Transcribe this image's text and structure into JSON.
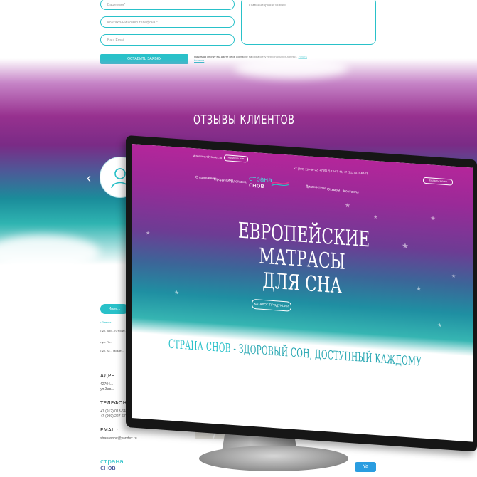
{
  "form": {
    "name_placeholder": "Ваше имя*",
    "phone_placeholder": "Контактный номер телефона *",
    "email_placeholder": "Ваш Email",
    "comment_placeholder": "Комментарий к заявке",
    "submit_label": "Оставить заявку",
    "consent_text": "Нажимая кнопку вы даете свое согласие на обработку персональных данных.",
    "consent_link": "Узнать больше"
  },
  "reviews": {
    "title": "Отзывы клиентов",
    "prev_arrow": "‹"
  },
  "contacts": {
    "button_label": "Инже...",
    "bullet_1": "• Завист...",
    "bullet_2": "• ул. Кир... (Строит...",
    "bullet_3": "• ул. Пр...",
    "bullet_4": "• ул. Ак... (возле...",
    "address_head": "Адре...",
    "address_text": "42704...\nул.Зав...",
    "phones_head": "Телефоны:",
    "phone_1": "+7 (912) 013-64-75",
    "phone_2": "+7 (999) 227-67-36",
    "email_head": "Email:",
    "email_value": "stranasnov@yandex.ru",
    "logo_top": "стрaна",
    "logo_bottom": "снов",
    "corner_badge": "Ya"
  },
  "screen": {
    "email": "stranasnov@yandex.ru",
    "write_us": "Написать нам",
    "phones": "+7 (999) 110-36-22, +7 (912) 13-87-46, +7 (912) 013-64-75",
    "call_me": "Заказать звонок",
    "nav_left": [
      "О компании",
      "Продукция",
      "Доставка"
    ],
    "nav_right": [
      "Диагностика",
      "Отзывы",
      "Контакты"
    ],
    "logo_top": "стрaна",
    "logo_bottom": "снов",
    "headline_line1": "Европейские",
    "headline_line2": "матрасы для сна",
    "cta_label": "Каталог продукции",
    "slogan_part1": "Страна снов",
    "slogan_part2": " - здоровый сон, доступный каждому"
  },
  "colors": {
    "accent_teal": "#29c1c9",
    "brand_magenta": "#b4269a",
    "brand_navy": "#2b3a8a"
  }
}
